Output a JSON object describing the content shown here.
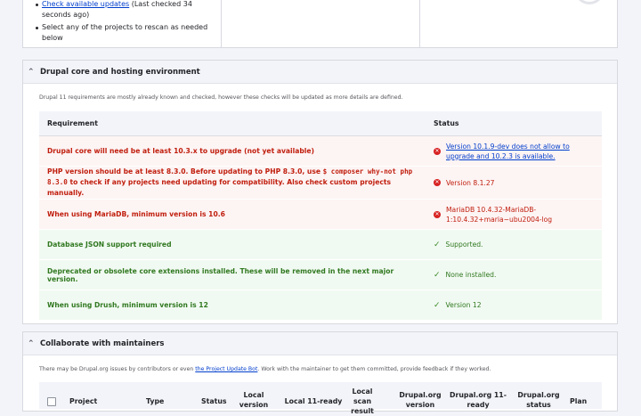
{
  "summary": {
    "items": [
      {
        "link": "Check available updates",
        "text": " (Last checked 34 seconds ago)"
      },
      {
        "link": "",
        "text": "Select any of the projects to rescan as needed below"
      }
    ]
  },
  "core_section": {
    "title": "Drupal core and hosting environment",
    "description": "Drupal 11 requirements are mostly already known and checked, however these checks will be updated as more details are defined.",
    "columns": {
      "requirement": "Requirement",
      "status": "Status"
    },
    "rows": [
      {
        "state": "error",
        "requirement": "Drupal core will need be at least 10.3.x to upgrade (not yet available)",
        "status_link": "Version 10.1.9-dev does not allow to upgrade and 10.2.3 is available.",
        "status": ""
      },
      {
        "state": "error",
        "requirement_pre": "PHP version should be at least 8.3.0. Before updating to PHP 8.3.0, use ",
        "requirement_code": "$ composer why-not php 8.3.0",
        "requirement_post": " to check if any projects need updating for compatibility. Also check custom projects manually.",
        "status": "Version 8.1.27"
      },
      {
        "state": "error",
        "requirement": "When using MariaDB, minimum version is 10.6",
        "status": "MariaDB 10.4.32-MariaDB-1:10.4.32+maria~ubu2004-log"
      },
      {
        "state": "ok",
        "requirement": "Database JSON support required",
        "status": "Supported."
      },
      {
        "state": "ok",
        "requirement": "Deprecated or obsolete core extensions installed. These will be removed in the next major version.",
        "status": "None installed."
      },
      {
        "state": "ok",
        "requirement": "When using Drush, minimum version is 12",
        "status": "Version 12"
      }
    ]
  },
  "maintainers_section": {
    "title": "Collaborate with maintainers",
    "description_pre": "There may be Drupal.org issues by contributors or even ",
    "description_link": "the Project Update Bot",
    "description_post": ". Work with the maintainer to get them committed, provide feedback if they worked.",
    "columns": [
      "Project",
      "Type",
      "Status",
      "Local version",
      "Local 11-ready",
      "Local scan result",
      "Drupal.org version",
      "Drupal.org 11-ready",
      "Drupal.org status",
      "Plan"
    ]
  },
  "colors": {
    "error": "#c01e0d",
    "error_bg": "#fdf4f4",
    "ok": "#307820",
    "ok_bg": "#f1faf2",
    "link": "#003ecc"
  }
}
